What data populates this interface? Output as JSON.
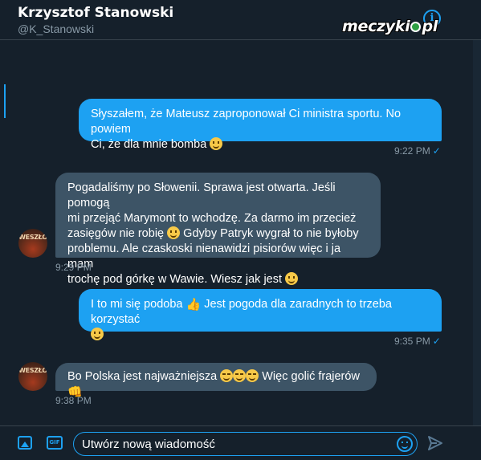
{
  "header": {
    "name": "Krzysztof Stanowski",
    "handle": "@K_Stanowski",
    "info_icon": "i"
  },
  "watermark": {
    "part1": "meczyki",
    "part2": "pl"
  },
  "messages": [
    {
      "direction": "sent",
      "text_1": "Słyszałem, że Mateusz zaproponował Ci ministra sportu. No powiem",
      "text_2": "Ci, że dla mnie bomba",
      "time": "9:22 PM"
    },
    {
      "direction": "received",
      "line1": "Pogadaliśmy po Słowenii. Sprawa jest otwarta. Jeśli pomogą",
      "line2": "mi przejąć Marymont to wchodzę. Za darmo im przecież",
      "line3a": "zasięgów nie robię",
      "line3b": "Gdyby Patryk wygrał to nie byłoby",
      "line4": "problemu. Ale czaskoski nienawidzi pisiorów więc i ja mam",
      "line5": "trochę pod górkę w Wawie. Wiesz jak jest",
      "time": "9:29 PM",
      "avatar_text": "WESZŁO"
    },
    {
      "direction": "sent",
      "text_1": "I to mi się podoba",
      "text_2": "Jest pogoda dla zaradnych to trzeba korzystać",
      "time": "9:35 PM"
    },
    {
      "direction": "received",
      "text_1": "Bo Polska jest najważniejsza",
      "text_2": "Więc golić frajerów",
      "time": "9:38 PM",
      "avatar_text": "WESZŁO"
    }
  ],
  "composer": {
    "placeholder": "Utwórz nową wiadomość",
    "gif_label": "GIF"
  },
  "icons": {
    "emoji_smile": "grinning-face",
    "emoji_joy": "face-with-tears-of-joy",
    "thumbs_up": "👍",
    "punch": "👊",
    "check": "✓"
  },
  "colors": {
    "background": "#15202b",
    "sent_bubble": "#1da1f2",
    "received_bubble": "#3d5466",
    "accent": "#1da1f2",
    "muted_text": "#8899a6"
  }
}
